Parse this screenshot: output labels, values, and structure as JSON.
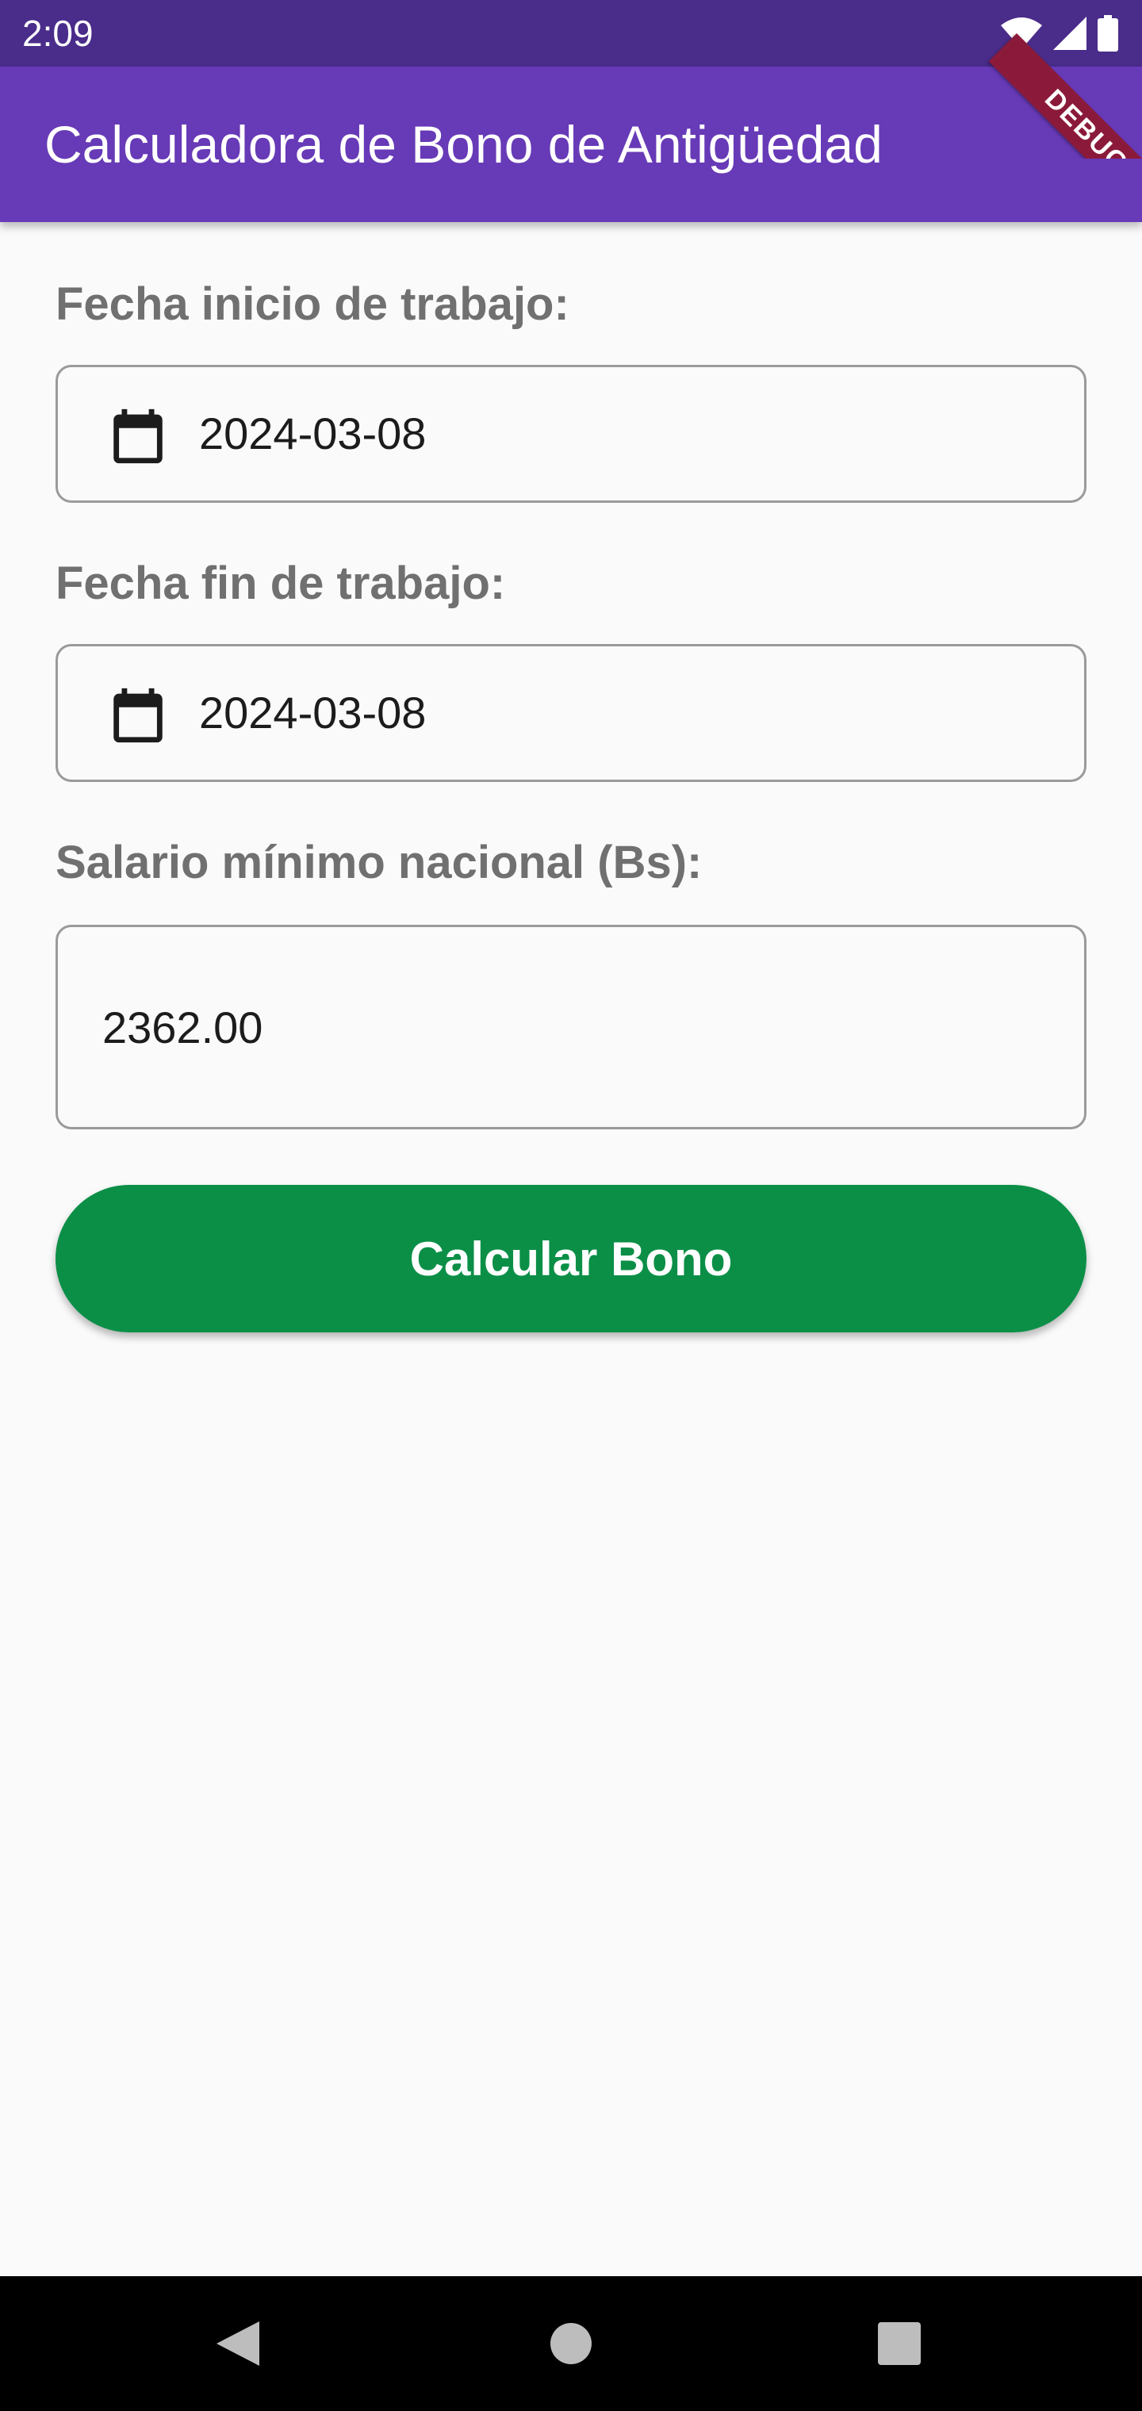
{
  "status_bar": {
    "time": "2:09",
    "icons": [
      "wifi-icon",
      "signal-icon",
      "battery-icon"
    ]
  },
  "app_bar": {
    "title": "Calculadora de Bono de Antigüedad",
    "background": "#673ab7"
  },
  "debug_banner": {
    "label": "DEBUG"
  },
  "form": {
    "start_date": {
      "label": "Fecha inicio de trabajo:",
      "value": "2024-03-08",
      "icon": "calendar-icon"
    },
    "end_date": {
      "label": "Fecha fin de trabajo:",
      "value": "2024-03-08",
      "icon": "calendar-icon"
    },
    "salary": {
      "label": "Salario mínimo nacional (Bs):",
      "value": "2362.00"
    },
    "submit": {
      "label": "Calcular Bono",
      "color": "#0b8f47"
    }
  },
  "nav_bar": {
    "buttons": [
      "back-icon",
      "home-icon",
      "recents-icon"
    ]
  }
}
